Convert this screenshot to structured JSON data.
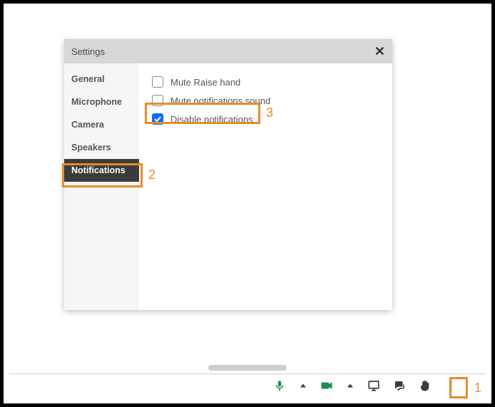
{
  "panel": {
    "title": "Settings",
    "tabs": [
      {
        "label": "General",
        "active": false
      },
      {
        "label": "Microphone",
        "active": false
      },
      {
        "label": "Camera",
        "active": false
      },
      {
        "label": "Speakers",
        "active": false
      },
      {
        "label": "Notifications",
        "active": true
      }
    ],
    "options": [
      {
        "label": "Mute Raise hand",
        "checked": false
      },
      {
        "label": "Mute notifications sound",
        "checked": false
      },
      {
        "label": "Disable notifications",
        "checked": true
      }
    ]
  },
  "annotations": {
    "step1": "1",
    "step2": "2",
    "step3": "3"
  },
  "colors": {
    "accent": "#e78b2a",
    "checkbox_checked": "#0b6cff",
    "icon_green": "#1a8f4a"
  }
}
